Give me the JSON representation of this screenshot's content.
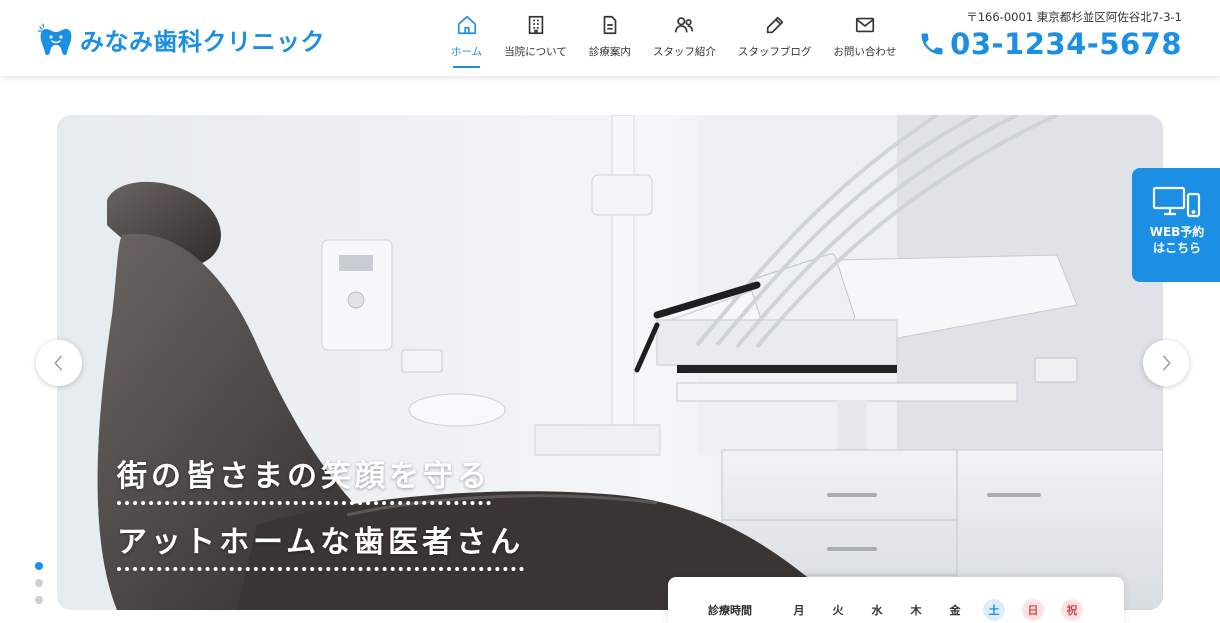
{
  "brand": {
    "name": "みなみ歯科クリニック",
    "color": "#1a8fe3"
  },
  "nav": {
    "items": [
      {
        "label": "ホーム",
        "icon": "home-icon",
        "active": true
      },
      {
        "label": "当院について",
        "icon": "building-icon",
        "active": false
      },
      {
        "label": "診療案内",
        "icon": "document-icon",
        "active": false
      },
      {
        "label": "スタッフ紹介",
        "icon": "users-icon",
        "active": false
      },
      {
        "label": "スタッフブログ",
        "icon": "pencil-icon",
        "active": false
      },
      {
        "label": "お問い合わせ",
        "icon": "mail-icon",
        "active": false
      }
    ]
  },
  "contact": {
    "address": "〒166-0001 東京都杉並区阿佐谷北7-3-1",
    "phone": "03-1234-5678"
  },
  "hero": {
    "line1": "街の皆さまの笑顔を守る",
    "line2": "アットホームな歯医者さん",
    "slide_count": 3,
    "active_slide": 1
  },
  "web_reservation": {
    "line1": "WEB予約",
    "line2": "はこちら"
  },
  "hours": {
    "title": "診療時間",
    "days": [
      {
        "label": "月",
        "type": "weekday"
      },
      {
        "label": "火",
        "type": "weekday"
      },
      {
        "label": "水",
        "type": "weekday"
      },
      {
        "label": "木",
        "type": "weekday"
      },
      {
        "label": "金",
        "type": "weekday"
      },
      {
        "label": "土",
        "type": "sat"
      },
      {
        "label": "日",
        "type": "sun"
      },
      {
        "label": "祝",
        "type": "hol"
      }
    ]
  }
}
